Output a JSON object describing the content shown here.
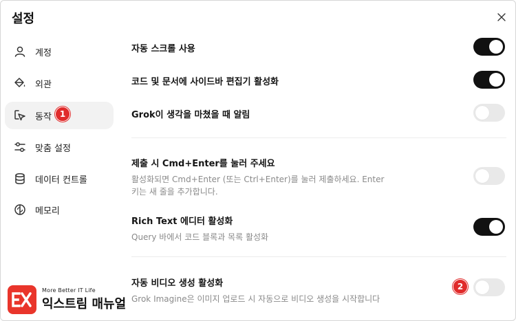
{
  "dialog": {
    "title": "설정"
  },
  "sidebar": {
    "items": [
      {
        "label": "계정",
        "icon": "user-icon"
      },
      {
        "label": "외관",
        "icon": "paint-bucket-icon"
      },
      {
        "label": "동작",
        "icon": "cursor-click-icon",
        "active": true
      },
      {
        "label": "맞춤 설정",
        "icon": "sliders-icon"
      },
      {
        "label": "데이터 컨트롤",
        "icon": "database-icon"
      },
      {
        "label": "메모리",
        "icon": "brain-icon"
      }
    ]
  },
  "settings": [
    {
      "title": "자동 스크롤 사용",
      "description": "",
      "enabled": true
    },
    {
      "title": "코드 및 문서에 사이드바 편집기 활성화",
      "description": "",
      "enabled": true
    },
    {
      "title": "Grok이 생각을 마쳤을 때 알림",
      "description": "",
      "enabled": false
    },
    {
      "title": "제출 시 Cmd+Enter를 눌러 주세요",
      "description": "활성화되면 Cmd+Enter (또는 Ctrl+Enter)를 눌러 제출하세요. Enter 키는 새 줄을 추가합니다.",
      "enabled": false
    },
    {
      "title": "Rich Text 에디터 활성화",
      "description": "Query 바에서 코드 블록과 목록 활성화",
      "enabled": true
    },
    {
      "title": "자동 비디오 생성 활성화",
      "description": "Grok Imagine은 이미지 업로드 시 자동으로 비디오 생성을 시작합니다",
      "enabled": false
    }
  ],
  "annotations": {
    "badge1": "1",
    "badge2": "2"
  },
  "watermark": {
    "tagline": "More Better IT Life",
    "name": "익스트림 매뉴얼"
  },
  "colors": {
    "toggle_on": "#111111",
    "toggle_off": "#e9e9e9",
    "badge": "#e02b2b",
    "brand": "#e9352b"
  }
}
